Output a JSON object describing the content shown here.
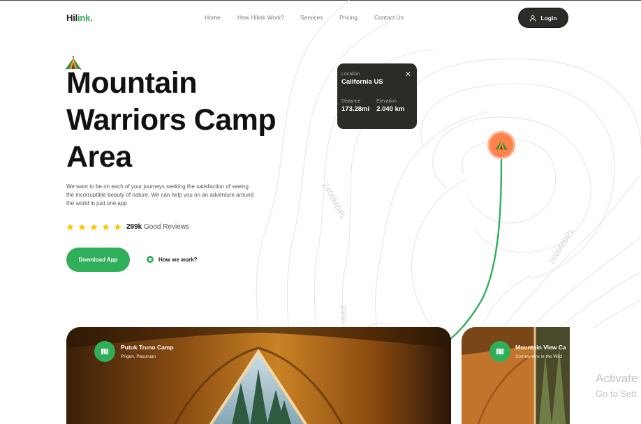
{
  "brand": {
    "logo_prefix": "Hil",
    "logo_suffix": "ink."
  },
  "nav": {
    "items": [
      "Home",
      "How Hilink Work?",
      "Services",
      "Pricing",
      "Contact Us"
    ],
    "login_label": "Login"
  },
  "hero": {
    "title_line1": "Mountain",
    "title_line2": "Warriors Camp",
    "title_line3": "Area",
    "description": "We want to be on each of your journeys seeking the satisfaction of seeing the incorruptible beauty of nature. We can help you on an adventure around the world in just one app",
    "rating_stars": 5,
    "reviews_count": "299k",
    "reviews_text": "Good Reviews",
    "download_label": "Download App",
    "how_label": "How we work?"
  },
  "location_card": {
    "location_label": "Location",
    "location_value": "California US",
    "distance_label": "Distance",
    "distance_value": "173.28mi",
    "elevation_label": "Elevation",
    "elevation_value": "2.040 km",
    "close_glyph": "✕"
  },
  "map": {
    "contour_labels": [
      "2400MDPL",
      "3600MDPL",
      "2000"
    ]
  },
  "camps": [
    {
      "name": "Putuk Truno Camp",
      "location": "Prigen, Pasuruan"
    },
    {
      "name": "Mountain View Ca",
      "location": "Somewhere in the Wild"
    }
  ],
  "watermark": {
    "line1": "Activate",
    "line2": "Go to Sett"
  },
  "colors": {
    "accent": "#30AF5B",
    "dark": "#292C27",
    "pin": "#FF814C",
    "star": "#FEC601"
  },
  "icons": {
    "user": "user-icon",
    "star": "star-icon",
    "close": "close-icon",
    "tent": "tent-icon",
    "map": "map-icon",
    "play": "play-icon"
  }
}
